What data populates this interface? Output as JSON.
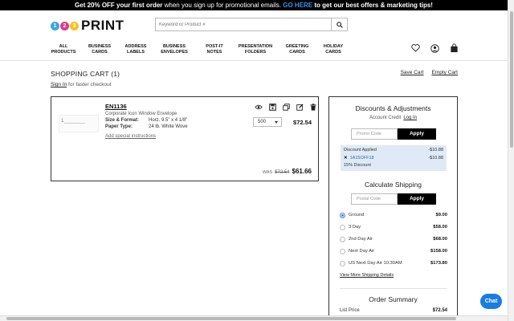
{
  "promo": {
    "lead": "Get 20% OFF your first order",
    "mid": " when you sign up for promotional emails. ",
    "link": "GO HERE",
    "tail": " to get our best offers & marketing tips!"
  },
  "logo": {
    "d1": "1",
    "d2": "2",
    "d3": "3",
    "word": "PRINT"
  },
  "search": {
    "placeholder": "Keyword or Product #",
    "icon": "search-icon"
  },
  "header_icons": [
    "heart-icon",
    "user-icon",
    "cart-icon"
  ],
  "nav": [
    {
      "label": "ALL\nPRODUCTS"
    },
    {
      "label": "BUSINESS\nCARDS"
    },
    {
      "label": "ADDRESS\nLABELS"
    },
    {
      "label": "BUSINESS\nENVELOPES"
    },
    {
      "label": "POST-IT\nNOTES"
    },
    {
      "label": "PRESENTATION\nFOLDERS"
    },
    {
      "label": "GREETING\nCARDS"
    },
    {
      "label": "HOLIDAY\nCARDS"
    }
  ],
  "cart": {
    "title": "SHOPPING CART (1)",
    "signin_link": "Sign In",
    "signin_text": " for faster checkout",
    "save_cart": "Save Cart",
    "empty_cart": "Empty Cart"
  },
  "item": {
    "thumb_text": "1",
    "sku": "EN1136",
    "description": "Corporate Icon Window Envelope",
    "size_label": "Size & Format:",
    "size_value": "Horz. 9.5\" x 4 1/8\"",
    "paper_label": "Paper Type:",
    "paper_value": "24 lb. White Wove",
    "add_instructions": "Add special instructions",
    "quantity": "500",
    "price": "$72.54",
    "was_label": "WAS",
    "was_price": "$72.54",
    "now_price": "$61.66",
    "action_icons": [
      "eye-icon",
      "save-icon",
      "duplicate-icon",
      "edit-icon",
      "trash-icon"
    ]
  },
  "summary": {
    "discounts_title": "Discounts & Adjustments",
    "account_credit": "Account Credit",
    "login": "Log In",
    "promo_placeholder": "Promo Code",
    "apply": "Apply",
    "discount_applied": "Discount Applied",
    "discount_applied_value": "-$10.88",
    "discount_code": "1A15OFF18",
    "discount_code_value": "-$10.88",
    "discount_pct": "15% Discount",
    "shipping_title": "Calculate Shipping",
    "postal_placeholder": "Postal Code",
    "shipping_options": [
      {
        "label": "Ground",
        "price": "$9.00",
        "selected": true
      },
      {
        "label": "3 Day",
        "price": "$58.00",
        "selected": false
      },
      {
        "label": "2nd Day Air",
        "price": "$68.00",
        "selected": false
      },
      {
        "label": "Next Day Air",
        "price": "$158.00",
        "selected": false
      },
      {
        "label": "US Next Day Air 10:30AM",
        "price": "$173.80",
        "selected": false
      }
    ],
    "more_shipping": "View More Shipping Details",
    "order_summary_title": "Order Summary",
    "list_price_label": "List Price",
    "list_price_value": "$72.54"
  },
  "chat": {
    "label": "Chat"
  }
}
